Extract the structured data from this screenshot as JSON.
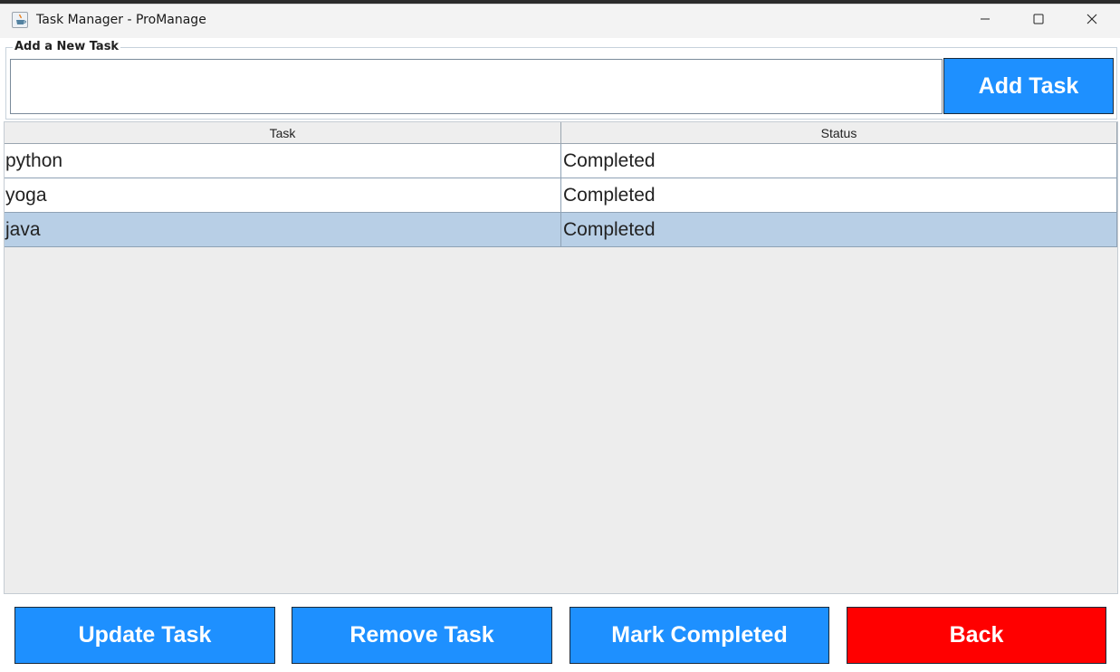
{
  "window": {
    "title": "Task Manager - ProManage"
  },
  "add_section": {
    "label": "Add a New Task",
    "input_value": "",
    "add_button_label": "Add Task"
  },
  "table": {
    "columns": [
      "Task",
      "Status"
    ],
    "rows": [
      {
        "task": "python",
        "status": "Completed",
        "selected": false
      },
      {
        "task": "yoga",
        "status": "Completed",
        "selected": false
      },
      {
        "task": "java",
        "status": "Completed",
        "selected": true
      }
    ]
  },
  "actions": {
    "update_label": "Update Task",
    "remove_label": "Remove Task",
    "mark_label": "Mark Completed",
    "back_label": "Back"
  },
  "colors": {
    "primary_button": "#1e90ff",
    "back_button": "#ff0000",
    "selected_row": "#b8cfe6"
  },
  "icons": {
    "app": "java-coffee-cup-icon",
    "minimize": "minimize-icon",
    "maximize": "maximize-icon",
    "close": "close-icon"
  }
}
